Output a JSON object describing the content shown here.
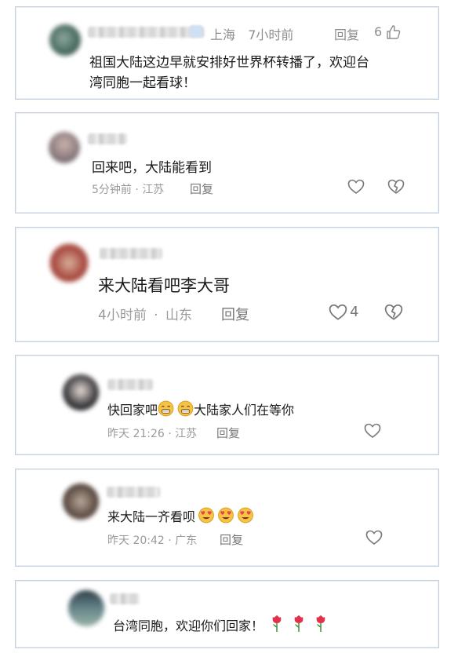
{
  "comments": [
    {
      "text_line1": "祖国大陆这边早就安排好世界杯转播了，欢迎台",
      "text_line2": "湾同胞一起看球！",
      "location": "上海",
      "time": "7小时前",
      "reply": "回复",
      "likes": "6"
    },
    {
      "text": "回来吧，大陆能看到",
      "meta": "5分钟前 · 江苏",
      "reply": "回复"
    },
    {
      "text": "来大陆看吧李大哥",
      "time": "4小时前",
      "sep": "·",
      "location": "山东",
      "reply": "回复",
      "likes": "4"
    },
    {
      "text_a": "快回家吧",
      "text_b": "大陆家人们在等你",
      "meta": "昨天 21:26 · 江苏",
      "reply": "回复"
    },
    {
      "text": "来大陆一齐看呗",
      "meta": "昨天 20:42 · 广东",
      "reply": "回复"
    },
    {
      "text": "台湾同胞，欢迎你们回家！"
    }
  ],
  "colors": {
    "border": "#c6d0dc",
    "meta": "#9a9a9a",
    "emoji_face": "#f6c343",
    "heart_emoji": "#e8434f",
    "rose": "#e0324a"
  },
  "icons": [
    "thumbs-up-icon",
    "heart-outline-icon",
    "broken-heart-icon",
    "grin-emoji-icon",
    "heart-eyes-emoji-icon",
    "rose-emoji-icon"
  ]
}
